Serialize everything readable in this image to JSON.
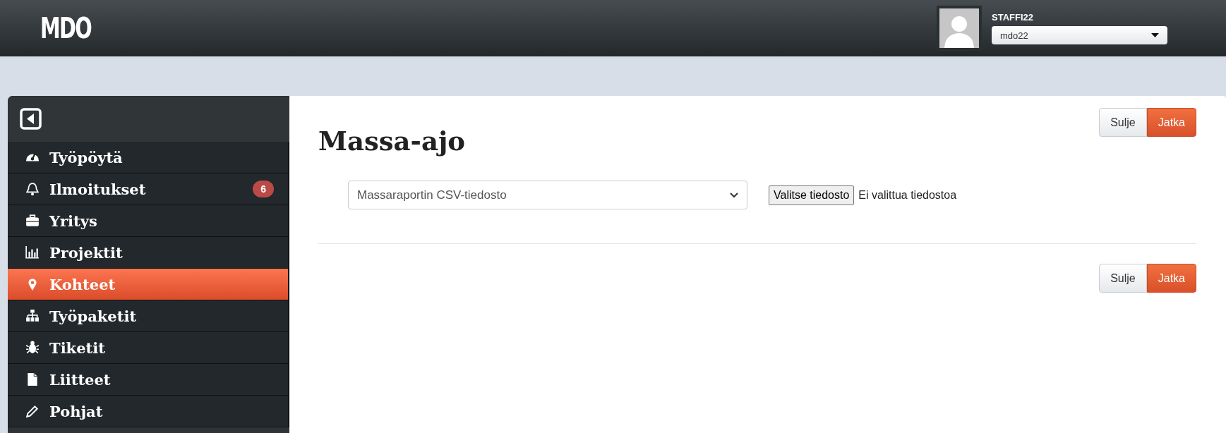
{
  "header": {
    "logo": "MDO",
    "user": {
      "name": "STAFFI22",
      "account": "mdo22"
    }
  },
  "sidebar": {
    "items": [
      {
        "label": "Työpöytä",
        "selected": false
      },
      {
        "label": "Ilmoitukset",
        "selected": false,
        "badge": "6"
      },
      {
        "label": "Yritys",
        "selected": false
      },
      {
        "label": "Projektit",
        "selected": false
      },
      {
        "label": "Kohteet",
        "selected": true
      },
      {
        "label": "Työpaketit",
        "selected": false
      },
      {
        "label": "Tiketit",
        "selected": false
      },
      {
        "label": "Liitteet",
        "selected": false
      },
      {
        "label": "Pohjat",
        "selected": false
      }
    ]
  },
  "main": {
    "title": "Massa-ajo",
    "report_select": {
      "value": "Massaraportin CSV-tiedosto"
    },
    "file_input": {
      "button": "Valitse tiedosto",
      "status": "Ei valittua tiedostoa"
    },
    "top_buttons": [
      "Sulje",
      "Jatka"
    ],
    "bottom_buttons": [
      "Sulje",
      "Jatka"
    ]
  }
}
